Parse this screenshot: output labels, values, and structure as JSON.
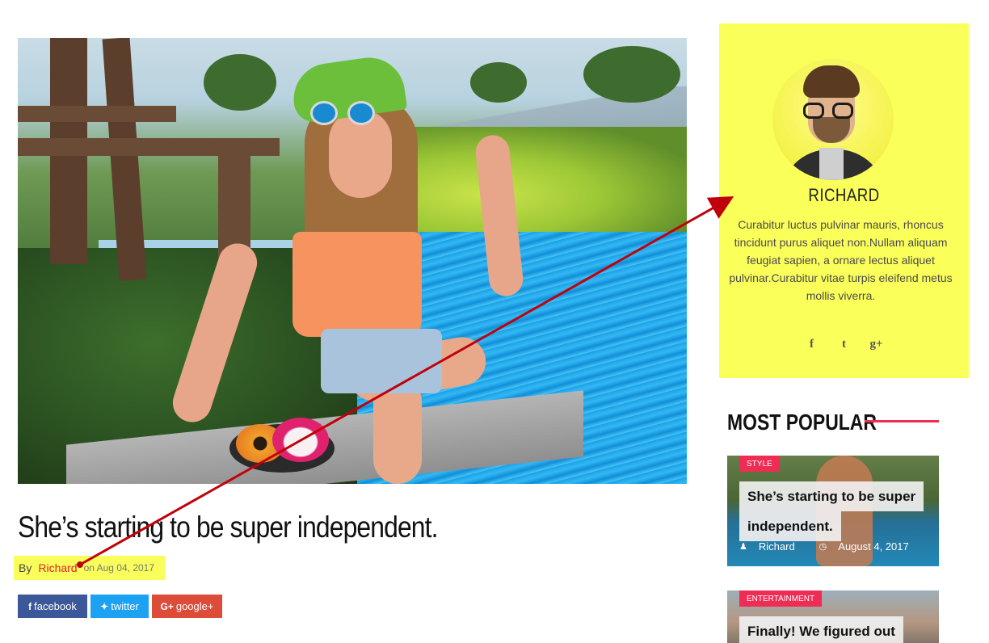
{
  "article": {
    "title": "She’s starting to be super independent.",
    "byline": {
      "by": "By",
      "author": "Richard",
      "date": "on Aug 04, 2017"
    },
    "share": [
      {
        "icon": "f",
        "label": "facebook",
        "color": "#3b5998"
      },
      {
        "icon": "🐦",
        "label": "twitter",
        "color": "#1da1f2"
      },
      {
        "icon": "G+",
        "label": "google+",
        "color": "#dd4b39"
      }
    ]
  },
  "author_box": {
    "name": "RICHARD",
    "bio": "Curabitur luctus pulvinar mauris, rhoncus tincidunt purus aliquet non.Nullam aliquam feugiat sapien, a ornare lectus aliquet pulvinar.Curabitur vitae turpis eleifend metus mollis viverra.",
    "social": [
      "f",
      "t",
      "g+"
    ],
    "background": "#fbff59"
  },
  "most_popular": {
    "title": "MOST POPULAR",
    "accent": "#ee2c54",
    "cards": [
      {
        "category": "STYLE",
        "title_line1": "She’s starting to be super",
        "title_line2": "independent.",
        "author": "Richard",
        "date": "August 4, 2017"
      },
      {
        "category": "ENTERTAINMENT",
        "title_line1": "Finally! We figured out"
      }
    ]
  },
  "annotation": {
    "color": "#c0000b"
  }
}
